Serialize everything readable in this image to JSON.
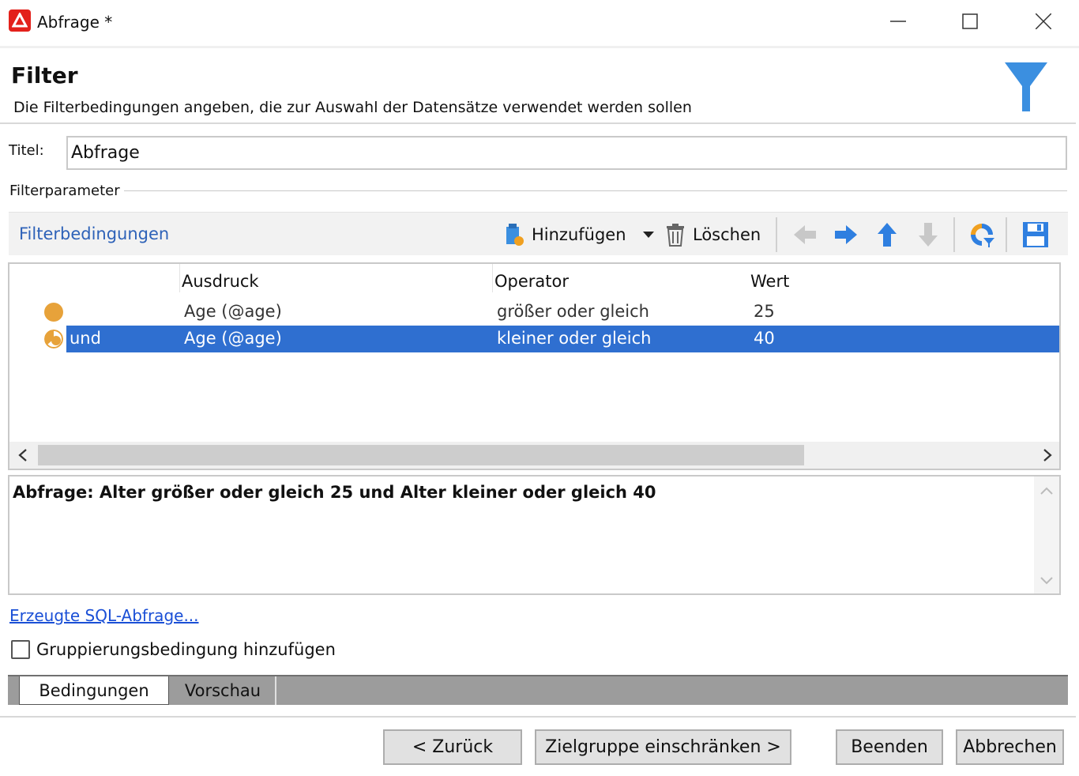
{
  "window": {
    "title": "Abfrage *"
  },
  "header": {
    "title": "Filter",
    "subtitle": "Die Filterbedingungen angeben, die zur Auswahl der Datensätze verwendet werden sollen"
  },
  "form": {
    "titel_label": "Titel:",
    "titel_value": "Abfrage",
    "group_label": "Filterparameter"
  },
  "toolbar": {
    "title": "Filterbedingungen",
    "add_label": "Hinzufügen",
    "delete_label": "Löschen"
  },
  "grid": {
    "columns": [
      "Ausdruck",
      "Operator",
      "Wert"
    ],
    "rows": [
      {
        "prefix": "",
        "expression": "Age (@age)",
        "operator": "größer oder gleich",
        "value": "25",
        "selected": false
      },
      {
        "prefix": "und",
        "expression": "Age (@age)",
        "operator": "kleiner oder gleich",
        "value": "40",
        "selected": true
      }
    ]
  },
  "description": {
    "text": "Abfrage: Alter größer oder gleich 25 und Alter kleiner oder gleich 40"
  },
  "links": {
    "sql": "Erzeugte SQL-Abfrage..."
  },
  "options": {
    "group_condition_label": "Gruppierungsbedingung hinzufügen",
    "group_condition_checked": false
  },
  "tabs": [
    {
      "label": "Bedingungen",
      "active": true
    },
    {
      "label": "Vorschau",
      "active": false
    }
  ],
  "footer": {
    "back_label": "< Zurück",
    "next_label": "Zielgruppe einschränken >",
    "finish_label": "Beenden",
    "cancel_label": "Abbrechen"
  },
  "colors": {
    "accent": "#2f6fd0",
    "link": "#1a4fd6",
    "funnel": "#3b8fe0",
    "condition_dot": "#e7a23a",
    "app_icon": "#e3211b"
  }
}
